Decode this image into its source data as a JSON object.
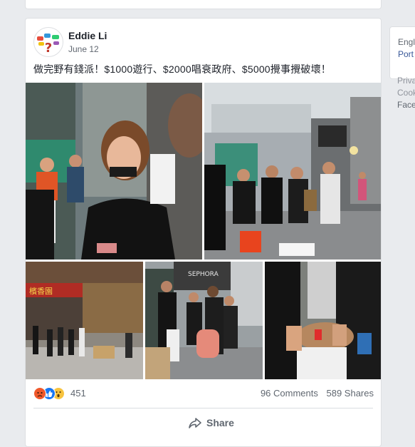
{
  "post": {
    "author": "Eddie Li",
    "date": "June 12",
    "caption": "做完野有錢派！$1000遊行、$2000唱衰政府、$5000攪事攪破壞！",
    "reactions": {
      "count": "451",
      "icons": [
        "angry-icon",
        "like-icon",
        "wow-icon"
      ]
    },
    "comments": "96 Comments",
    "shares": "589 Shares",
    "share_label": "Share",
    "photo_signs": {
      "shop_sign": "檳香園",
      "store_sign": "SEPHORA"
    }
  },
  "sidebar": {
    "language_current": "Engl",
    "language_other": "Port",
    "footer_links": [
      "Priva",
      "Cooki",
      "Face"
    ]
  },
  "colors": {
    "link": "#385898",
    "text": "#1d2129",
    "secondary": "#606770",
    "background": "#e9ebee"
  }
}
